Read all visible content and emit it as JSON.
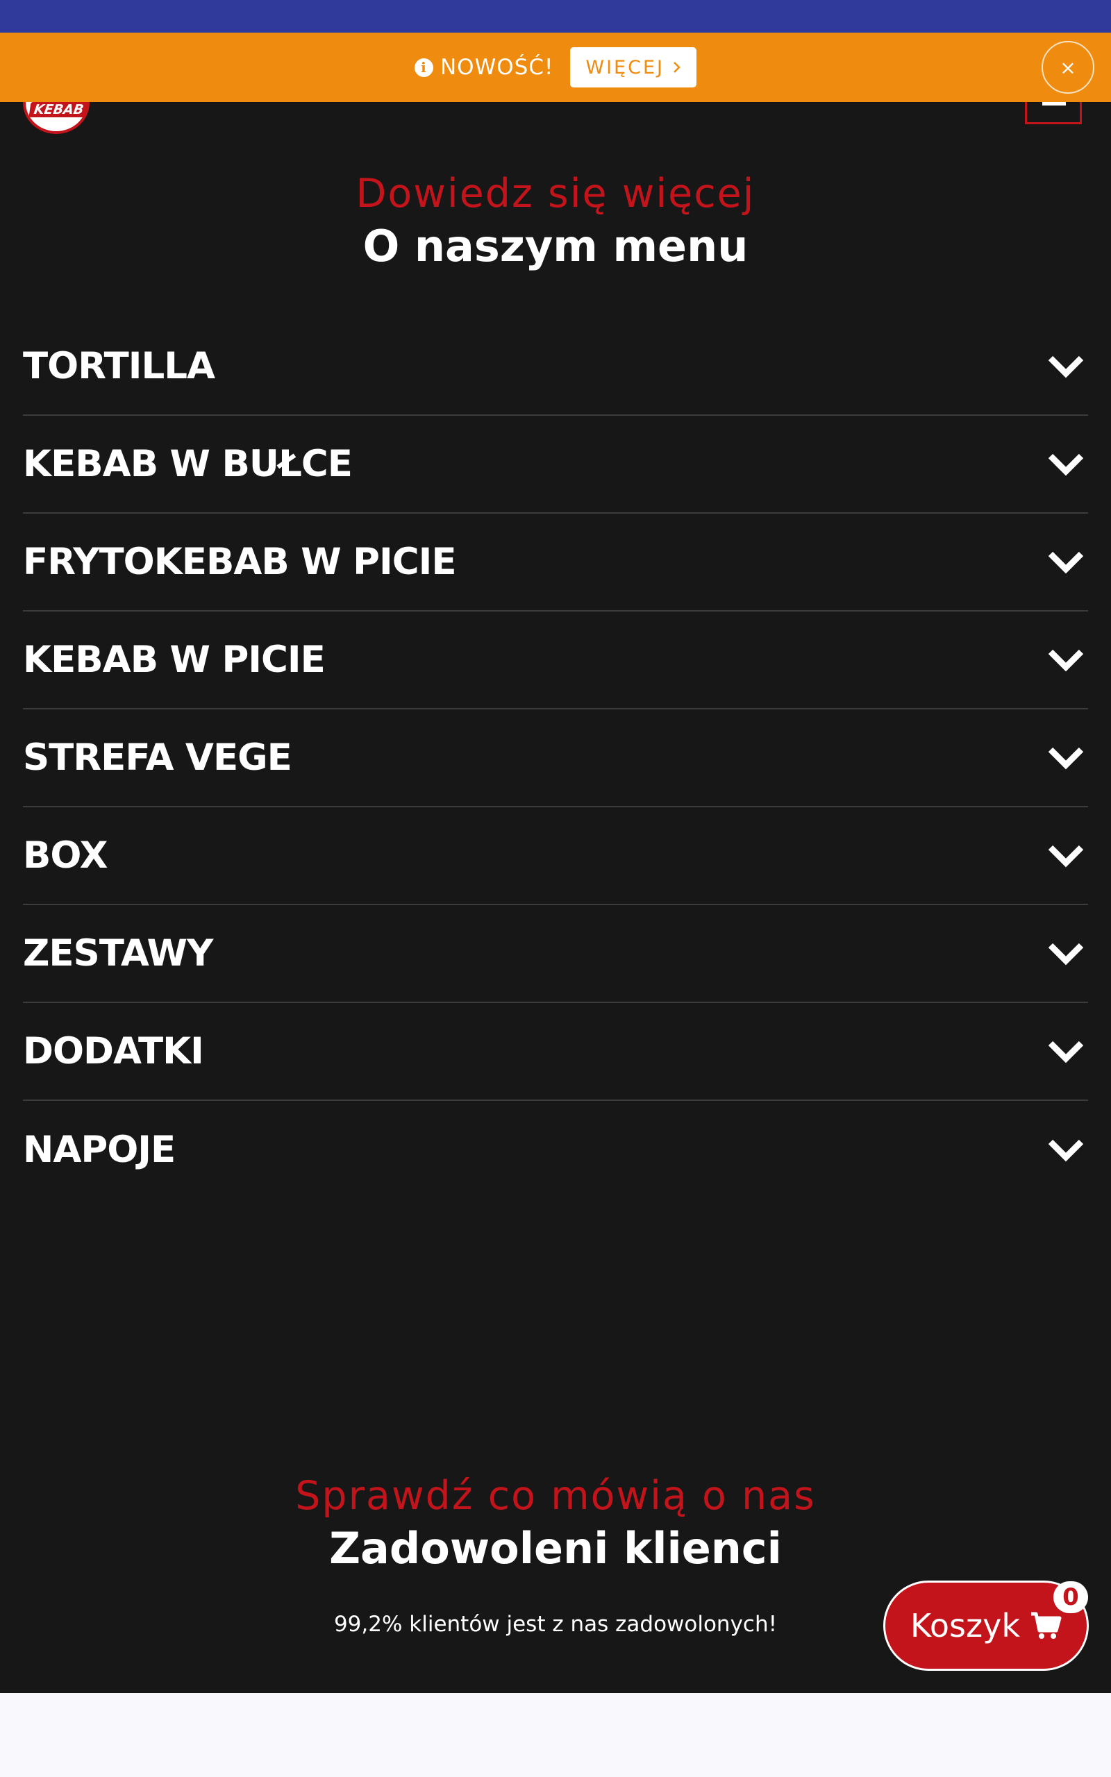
{
  "notice_bar": {
    "text": "NOWOŚĆ!",
    "more_label": "WIĘCEJ",
    "close_label": "×"
  },
  "logo": {
    "text": "KEBAB"
  },
  "menu_section": {
    "subtitle": "Dowiedz się więcej",
    "title": "O naszym menu",
    "categories": [
      {
        "label": "TORTILLA"
      },
      {
        "label": "KEBAB W BUŁCE"
      },
      {
        "label": "FRYTOKEBAB W PICIE"
      },
      {
        "label": "KEBAB W PICIE"
      },
      {
        "label": "STREFA VEGE"
      },
      {
        "label": "BOX"
      },
      {
        "label": "ZESTAWY"
      },
      {
        "label": "DODATKI"
      },
      {
        "label": "NAPOJE"
      }
    ]
  },
  "reviews_section": {
    "subtitle": "Sprawdź co mówią o nas",
    "title": "Zadowoleni klienci",
    "note": "99,2% klientów jest z nas zadowolonych!"
  },
  "cart": {
    "label": "Koszyk",
    "count": "0"
  },
  "colors": {
    "top_bar": "#2f3a9a",
    "notice_bar": "#ef8c0f",
    "accent_red": "#c4141b",
    "background": "#171717",
    "footer": "#f8f8fd"
  }
}
